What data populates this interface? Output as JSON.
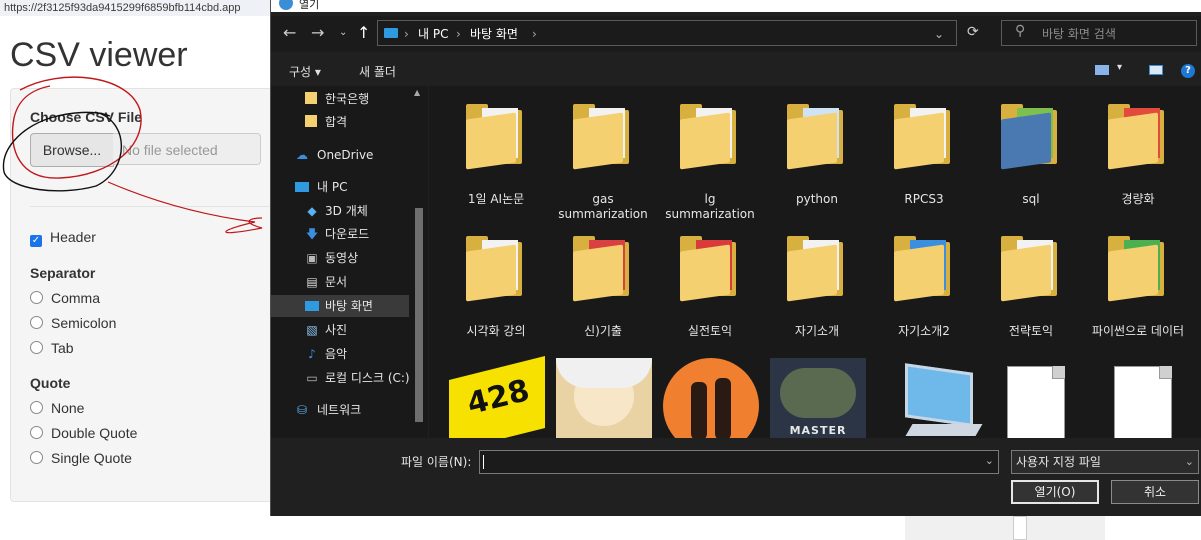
{
  "browser": {
    "url": "https://2f3125f93da9415299f6859bfb114cbd.app"
  },
  "page": {
    "title": "CSV viewer",
    "choose_label": "Choose CSV File",
    "browse_label": "Browse...",
    "file_placeholder": "No file selected",
    "header_label": "Header",
    "separator_title": "Separator",
    "separator_options": [
      "Comma",
      "Semicolon",
      "Tab"
    ],
    "quote_title": "Quote",
    "quote_options": [
      "None",
      "Double Quote",
      "Single Quote"
    ]
  },
  "dialog": {
    "title": "열기",
    "breadcrumb": [
      "내 PC",
      "바탕 화면"
    ],
    "search_placeholder": "바탕 화면 검색",
    "toolbar": {
      "organize": "구성 ▾",
      "new_folder": "새 폴더"
    },
    "sidebar": [
      {
        "label": "한국은행",
        "icon": "folder-icon"
      },
      {
        "label": "합격",
        "icon": "folder-icon"
      },
      {
        "label": "OneDrive",
        "icon": "cloud-icon"
      },
      {
        "label": "내 PC",
        "icon": "pc-icon"
      },
      {
        "label": "3D 개체",
        "icon": "cube-icon"
      },
      {
        "label": "다운로드",
        "icon": "download-icon"
      },
      {
        "label": "동영상",
        "icon": "video-icon"
      },
      {
        "label": "문서",
        "icon": "document-icon"
      },
      {
        "label": "바탕 화면",
        "icon": "desktop-icon",
        "selected": true
      },
      {
        "label": "사진",
        "icon": "picture-icon"
      },
      {
        "label": "음악",
        "icon": "music-icon"
      },
      {
        "label": "로컬 디스크 (C:)",
        "icon": "drive-icon"
      },
      {
        "label": "네트워크",
        "icon": "network-icon"
      }
    ],
    "files_row1": [
      "1일 AI논문",
      "gas summarization",
      "lg summarization",
      "python",
      "RPCS3",
      "sql",
      "경량화"
    ],
    "files_row2": [
      "시각화 강의",
      "신)기출",
      "실전토익",
      "자기소개",
      "자기소개2",
      "전략토익",
      "파이썬으로 데이터"
    ],
    "thumb_texts": [
      "428",
      "MASTER DUEL"
    ],
    "filename_label": "파일 이름(N):",
    "filename_value": "",
    "filetype_value": "사용자 지정 파일",
    "open_label": "열기(O)",
    "cancel_label": "취소"
  },
  "colors": {
    "accent": "#2f9ae0",
    "folder": "#f5d070",
    "annotation": "#c0181a"
  }
}
